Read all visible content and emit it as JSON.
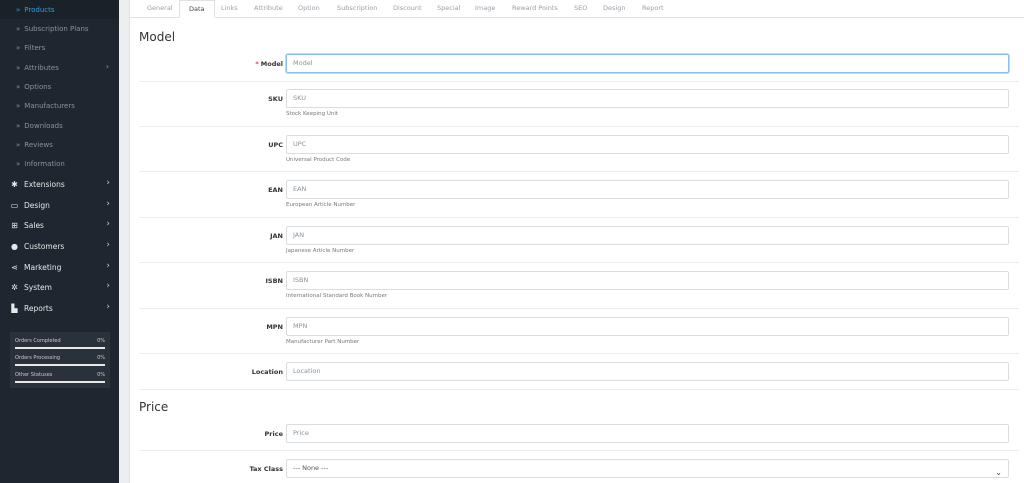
{
  "sidebar": {
    "sub_items": [
      {
        "label": "Products",
        "active": true
      },
      {
        "label": "Subscription Plans"
      },
      {
        "label": "Filters"
      },
      {
        "label": "Attributes",
        "has_children": true
      },
      {
        "label": "Options"
      },
      {
        "label": "Manufacturers"
      },
      {
        "label": "Downloads"
      },
      {
        "label": "Reviews"
      },
      {
        "label": "Information"
      }
    ],
    "main_items": [
      {
        "label": "Extensions",
        "icon": "puzzle-icon",
        "glyph": "✱"
      },
      {
        "label": "Design",
        "icon": "monitor-icon",
        "glyph": "▭"
      },
      {
        "label": "Sales",
        "icon": "cart-icon",
        "glyph": "⊞"
      },
      {
        "label": "Customers",
        "icon": "user-icon",
        "glyph": "●"
      },
      {
        "label": "Marketing",
        "icon": "share-icon",
        "glyph": "⋖"
      },
      {
        "label": "System",
        "icon": "gear-icon",
        "glyph": "✲"
      },
      {
        "label": "Reports",
        "icon": "chart-icon",
        "glyph": "▙"
      }
    ],
    "stats": [
      {
        "label": "Orders Completed",
        "value": "0%"
      },
      {
        "label": "Orders Processing",
        "value": "0%"
      },
      {
        "label": "Other Statuses",
        "value": "0%"
      }
    ]
  },
  "tabs": [
    "General",
    "Data",
    "Links",
    "Attribute",
    "Option",
    "Subscription",
    "Discount",
    "Special",
    "Image",
    "Reward Points",
    "SEO",
    "Design",
    "Report"
  ],
  "active_tab": "Data",
  "sections": {
    "model_title": "Model",
    "price_title": "Price"
  },
  "fields": [
    {
      "label": "Model",
      "required": true,
      "placeholder": "Model",
      "help": ""
    },
    {
      "label": "SKU",
      "placeholder": "SKU",
      "help": "Stock Keeping Unit"
    },
    {
      "label": "UPC",
      "placeholder": "UPC",
      "help": "Universal Product Code"
    },
    {
      "label": "EAN",
      "placeholder": "EAN",
      "help": "European Article Number"
    },
    {
      "label": "JAN",
      "placeholder": "JAN",
      "help": "Japanese Article Number"
    },
    {
      "label": "ISBN",
      "placeholder": "ISBN",
      "help": "International Standard Book Number"
    },
    {
      "label": "MPN",
      "placeholder": "MPN",
      "help": "Manufacturer Part Number"
    },
    {
      "label": "Location",
      "placeholder": "Location",
      "help": ""
    }
  ],
  "price_fields": [
    {
      "label": "Price",
      "placeholder": "Price"
    },
    {
      "label": "Tax Class",
      "value": "--- None ---"
    }
  ]
}
